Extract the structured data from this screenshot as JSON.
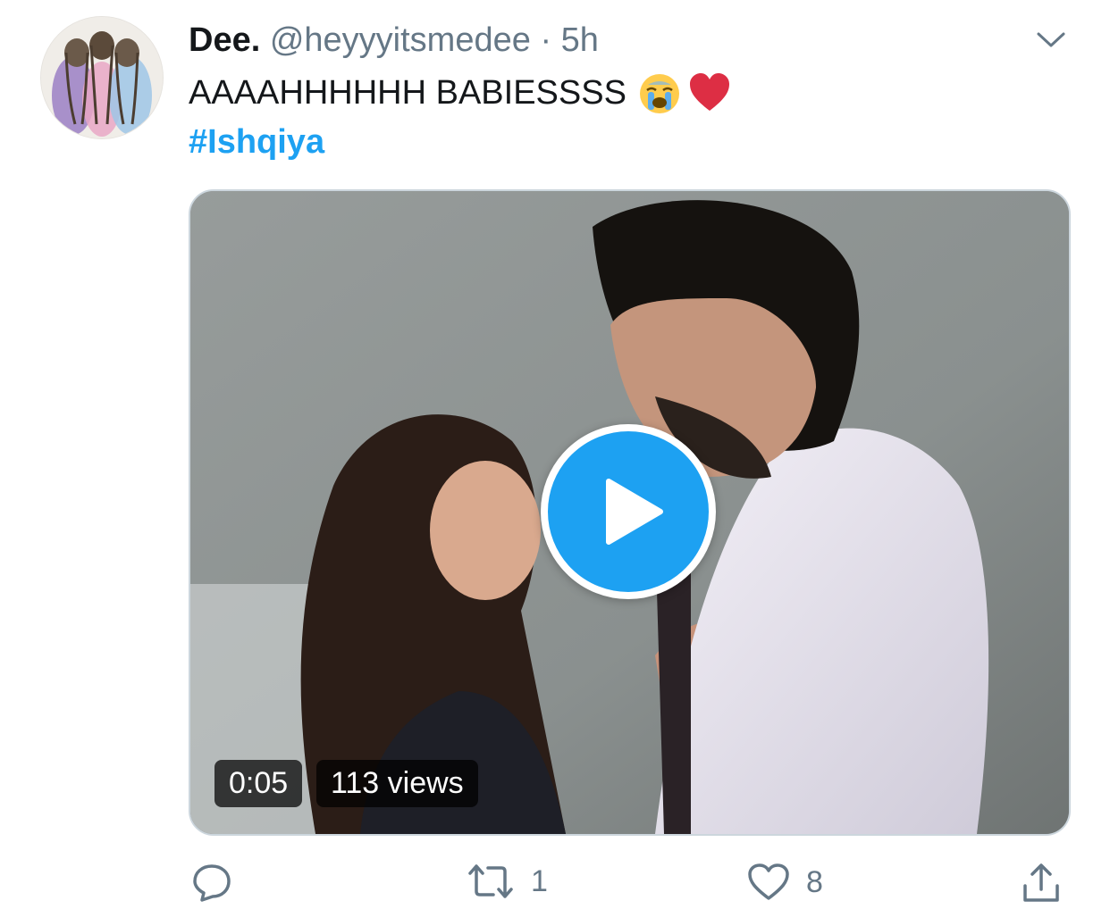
{
  "tweet": {
    "display_name": "Dee.",
    "handle": "@heyyyitsmedee",
    "separator": "·",
    "time": "5h",
    "text": "AAAAHHHHHH BABIESSSS",
    "emojis": [
      "crying-face-emoji",
      "red-heart-emoji"
    ],
    "hashtag": "#Ishqiya"
  },
  "video": {
    "duration": "0:05",
    "views": "113 views"
  },
  "actions": {
    "reply_count": "",
    "retweet_count": "1",
    "like_count": "8"
  },
  "icons": {
    "menu": "chevron-down-icon",
    "play": "play-icon",
    "reply": "reply-icon",
    "retweet": "retweet-icon",
    "like": "heart-icon",
    "share": "share-icon"
  },
  "colors": {
    "accent": "#1da1f2",
    "secondary_text": "#657786",
    "primary_text": "#14171a",
    "border": "#ccd6dd"
  }
}
